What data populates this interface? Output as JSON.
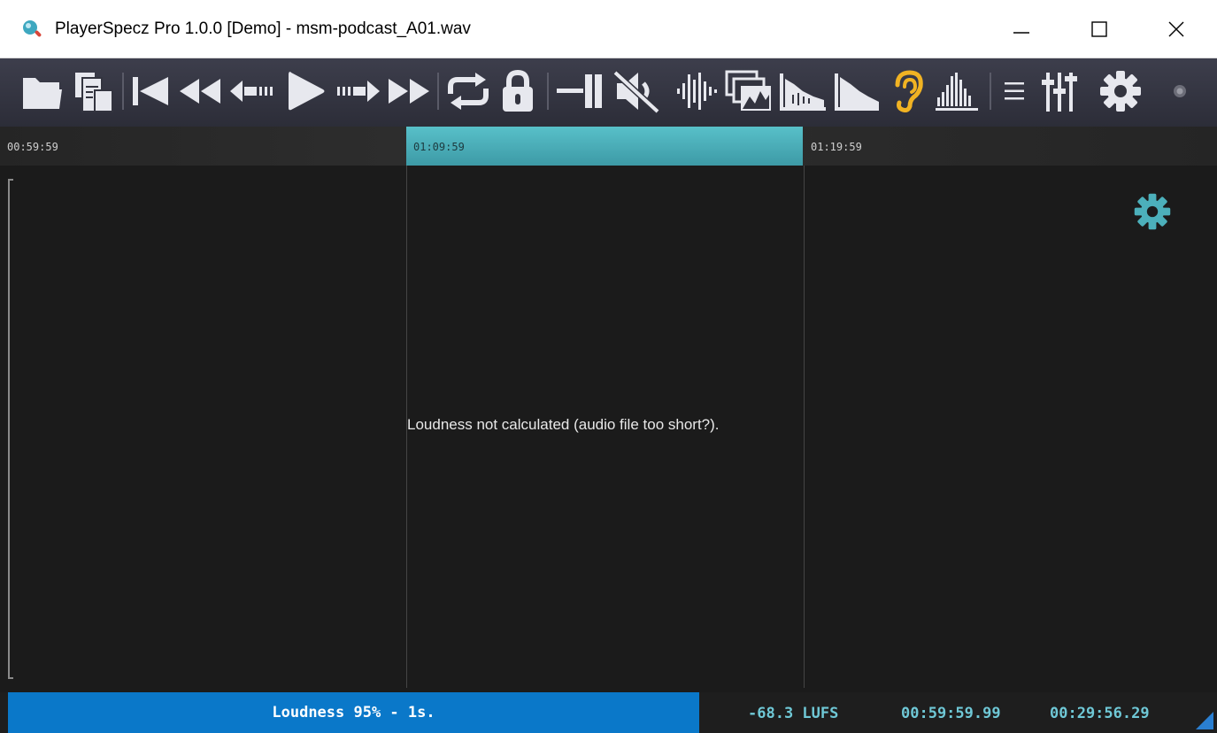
{
  "window": {
    "title": "PlayerSpecz Pro 1.0.0 [Demo] - msm-podcast_A01.wav",
    "icon": "magnifier-app-icon"
  },
  "toolbar": {
    "icons": [
      "open-folder-icon",
      "open-recent-files-icon",
      "skip-to-start-icon",
      "rewind-icon",
      "step-back-icon",
      "play-icon",
      "step-forward-icon",
      "fast-forward-icon",
      "loop-icon",
      "lock-icon",
      "marker-icon",
      "mute-icon",
      "waveform-icon",
      "spectrogram-icon",
      "spectrum-icon",
      "loudness-icon",
      "ear-icon",
      "histogram-icon",
      "menu-icon",
      "mixer-icon",
      "settings-gear-icon",
      "status-dot-icon"
    ],
    "accent_color": "#e7e8ee",
    "ear_color": "#f1b323"
  },
  "ruler": {
    "times": [
      "00:59:59",
      "01:09:59",
      "01:19:59"
    ],
    "active_index": 1,
    "active_color": "#4cb0bb"
  },
  "main": {
    "message": "Loudness not calculated (audio file too short?).",
    "gear_color": "#4cb0bb"
  },
  "status": {
    "progress_text": "Loudness 95% - 1s.",
    "lufs": "-68.3 LUFS",
    "position": "00:59:59.99",
    "duration": "00:29:56.29",
    "progress_color": "#0a78c9",
    "value_color": "#6fc8d6"
  }
}
